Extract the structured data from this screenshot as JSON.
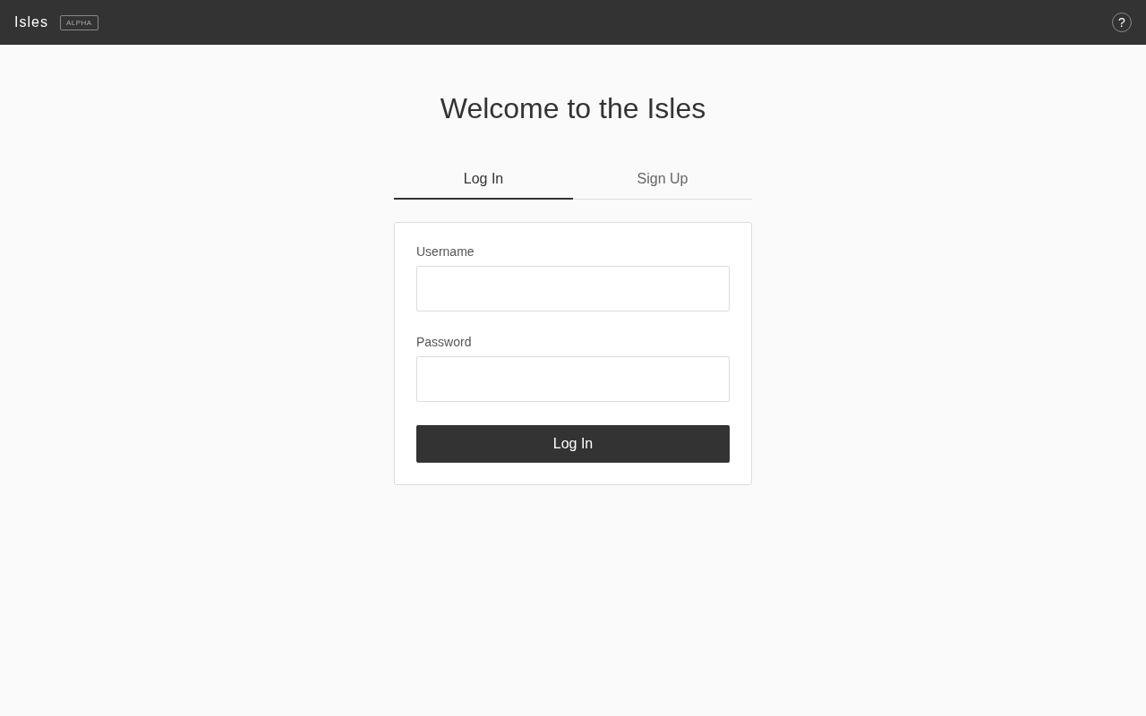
{
  "header": {
    "title": "Isles",
    "badge": "ALPHA",
    "help": "?"
  },
  "heading": "Welcome to the Isles",
  "tabs": [
    {
      "label": "Log In",
      "selected": true
    },
    {
      "label": "Sign Up",
      "selected": false
    }
  ],
  "form": {
    "fields": [
      {
        "label": "Username"
      },
      {
        "label": "Password"
      }
    ],
    "submit": "Log In"
  }
}
